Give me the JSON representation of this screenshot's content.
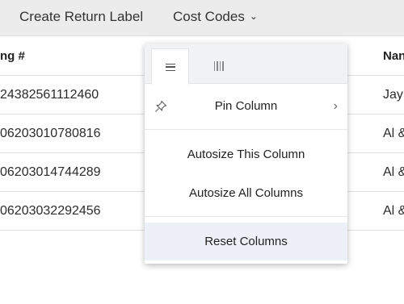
{
  "toolbar": {
    "create_label": "Create Return Label",
    "cost_codes": "Cost Codes",
    "chevron": "⌄"
  },
  "grid": {
    "headers": [
      "ng #",
      "Nan"
    ],
    "rows": [
      {
        "tracking": "24382561112460",
        "name": "Jay"
      },
      {
        "tracking": "06203010780816",
        "name": "Al &"
      },
      {
        "tracking": "06203014744289",
        "name": "Al &"
      },
      {
        "tracking": "06203032292456",
        "name": "Al &"
      }
    ]
  },
  "column_menu": {
    "tabs": [
      {
        "icon": "menu-icon",
        "active": true
      },
      {
        "icon": "columns-icon",
        "active": false
      }
    ],
    "pin_column": "Pin Column",
    "pin_chevron": "›",
    "autosize_this": "Autosize This Column",
    "autosize_all": "Autosize All Columns",
    "reset_columns": "Reset Columns"
  },
  "colors": {
    "toolbar_bg": "#ececec",
    "menu_tab_bg": "#f1f2f3",
    "reset_bg": "#eef0f7"
  }
}
